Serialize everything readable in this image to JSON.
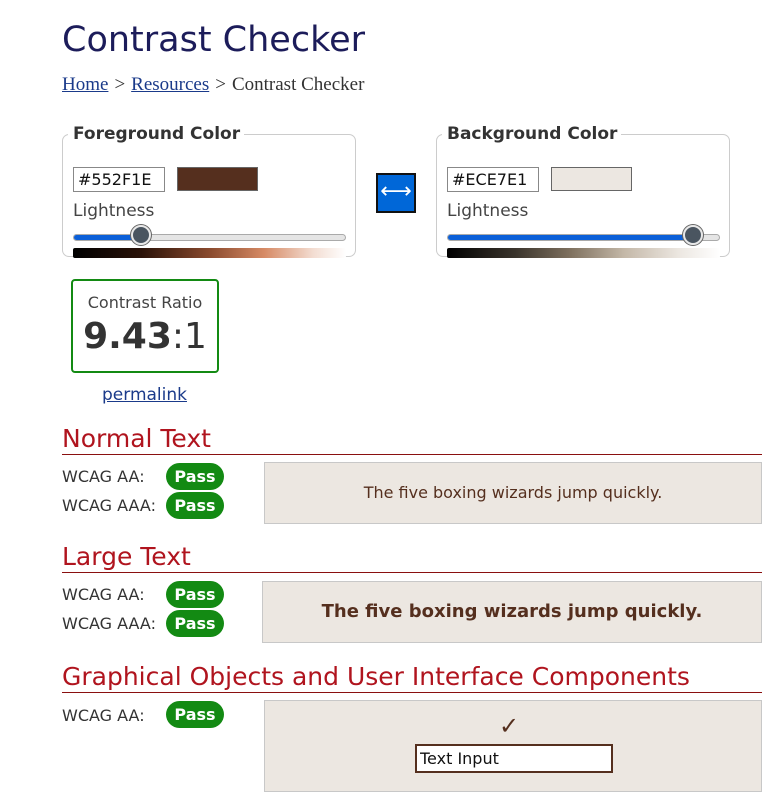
{
  "page": {
    "title": "Contrast Checker"
  },
  "breadcrumb": {
    "home": "Home",
    "separator": ">",
    "resources": "Resources",
    "current": "Contrast Checker"
  },
  "foreground": {
    "legend": "Foreground Color",
    "hex": "#552F1E",
    "swatch_color": "#552F1E",
    "lightness_label": "Lightness",
    "lightness_percent": 25
  },
  "background": {
    "legend": "Background Color",
    "hex": "#ECE7E1",
    "swatch_color": "#ECE7E1",
    "lightness_label": "Lightness",
    "lightness_percent": 90
  },
  "swap": {
    "icon": "swap-arrows-icon",
    "glyph": "⟷"
  },
  "contrast": {
    "label": "Contrast Ratio",
    "value": "9.43",
    "suffix": ":1"
  },
  "permalink": "permalink",
  "normal_text": {
    "heading": "Normal Text",
    "aa_label": "WCAG AA:",
    "aa_result": "Pass",
    "aaa_label": "WCAG AAA:",
    "aaa_result": "Pass",
    "sample": "The five boxing wizards jump quickly."
  },
  "large_text": {
    "heading": "Large Text",
    "aa_label": "WCAG AA:",
    "aa_result": "Pass",
    "aaa_label": "WCAG AAA:",
    "aaa_result": "Pass",
    "sample": "The five boxing wizards jump quickly."
  },
  "graphical": {
    "heading": "Graphical Objects and User Interface Components",
    "aa_label": "WCAG AA:",
    "aa_result": "Pass",
    "check_glyph": "✓",
    "input_value": "Text Input"
  },
  "colors": {
    "pass_green": "#138A13",
    "heading_red": "#B0141E",
    "accent_blue": "#0067D8"
  }
}
